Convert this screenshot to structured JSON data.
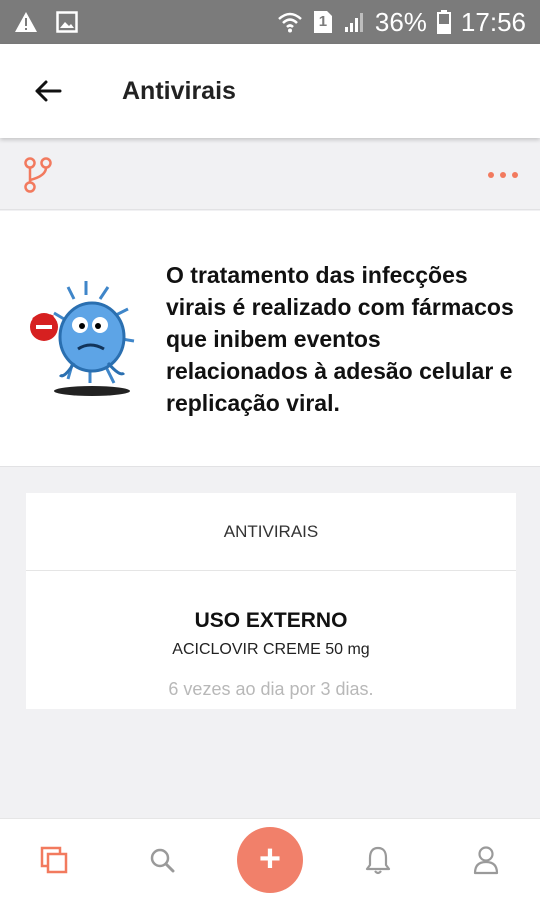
{
  "status_bar": {
    "battery": "36%",
    "time": "17:56",
    "sim": "1",
    "icons": [
      "warning-icon",
      "image-icon",
      "wifi-icon",
      "sim-icon",
      "signal-icon",
      "battery-icon"
    ]
  },
  "header": {
    "title": "Antivirais",
    "back_icon": "arrow-left-icon"
  },
  "action_row": {
    "left_icon": "branch-icon",
    "right_icon": "more-dots-icon"
  },
  "intro": {
    "image": "virus-cartoon",
    "text": "O tratamento das infecções virais é realizado com fármacos que inibem eventos relacionados à adesão celular e replicação viral."
  },
  "card": {
    "header": "ANTIVIRAIS",
    "use": "USO EXTERNO",
    "drug": "ACICLOVIR CREME 50 mg",
    "dosage": "6 vezes ao dia por 3 dias."
  },
  "bottom_nav": {
    "items": [
      "copy-icon",
      "search-icon",
      "plus-icon",
      "bell-icon",
      "user-icon"
    ],
    "fab_label": "+"
  },
  "colors": {
    "accent": "#f27a5e",
    "fab": "#f1806a",
    "status_bar": "#7b7b7b",
    "background": "#f1f1f3"
  }
}
